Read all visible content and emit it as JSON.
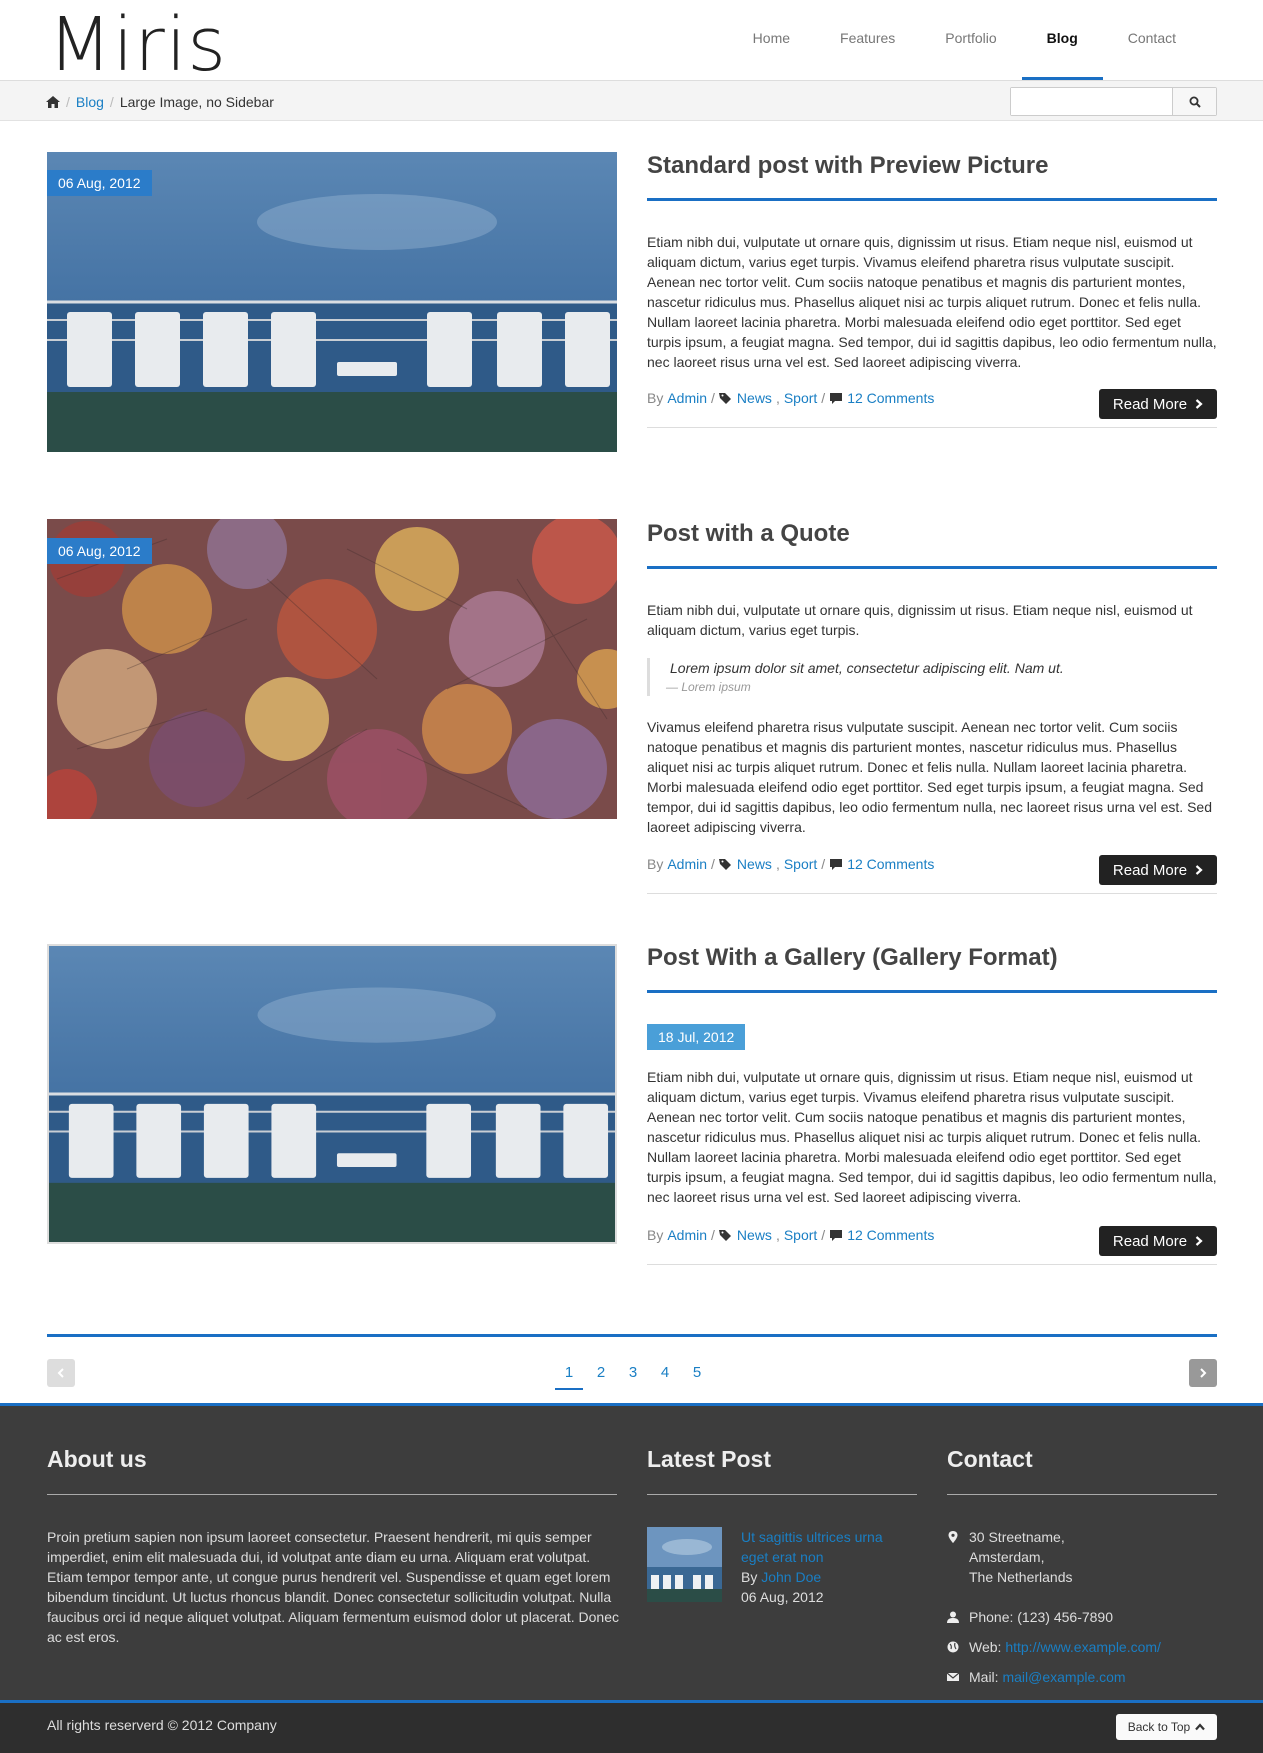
{
  "brand": {
    "logo": "Miris",
    "accent": "#1a6fc4"
  },
  "nav": {
    "items": [
      {
        "label": "Home",
        "active": false
      },
      {
        "label": "Features",
        "active": false
      },
      {
        "label": "Portfolio",
        "active": false
      },
      {
        "label": "Blog",
        "active": true
      },
      {
        "label": "Contact",
        "active": false
      }
    ]
  },
  "breadcrumb": {
    "home_icon": "home-icon",
    "blog": "Blog",
    "current": "Large Image, no Sidebar"
  },
  "search": {
    "placeholder": "",
    "icon": "search-icon"
  },
  "posts": [
    {
      "date": "06 Aug, 2012",
      "title": "Standard post with Preview Picture",
      "body": "Etiam nibh dui, vulputate ut ornare quis, dignissim ut risus. Etiam neque nisl, euismod ut aliquam dictum, varius eget turpis. Vivamus eleifend pharetra risus vulputate suscipit. Aenean nec tortor velit. Cum sociis natoque penatibus et magnis dis parturient montes, nascetur ridiculus mus. Phasellus aliquet nisi ac turpis aliquet rutrum. Donec et felis nulla. Nullam laoreet lacinia pharetra. Morbi malesuada eleifend odio eget porttitor. Sed eget turpis ipsum, a feugiat magna. Sed tempor, dui id sagittis dapibus, leo odio fermentum nulla, nec laoreet risus urna vel est. Sed laoreet adipiscing viverra.",
      "meta": {
        "by": "By",
        "author": "Admin",
        "tag1": "News",
        "tag2": "Sport",
        "comments": "12 Comments"
      },
      "read_more": "Read More"
    },
    {
      "date": "06 Aug, 2012",
      "title": "Post with a Quote",
      "body_intro": "Etiam nibh dui, vulputate ut ornare quis, dignissim ut risus. Etiam neque nisl, euismod ut aliquam dictum, varius eget turpis.",
      "quote": "Lorem ipsum dolor sit amet, consectetur adipiscing elit. Nam ut.",
      "quote_source": "— Lorem ipsum",
      "body": "Vivamus eleifend pharetra risus vulputate suscipit. Aenean nec tortor velit. Cum sociis natoque penatibus et magnis dis parturient montes, nascetur ridiculus mus. Phasellus aliquet nisi ac turpis aliquet rutrum. Donec et felis nulla. Nullam laoreet lacinia pharetra. Morbi malesuada eleifend odio eget porttitor. Sed eget turpis ipsum, a feugiat magna. Sed tempor, dui id sagittis dapibus, leo odio fermentum nulla, nec laoreet risus urna vel est. Sed laoreet adipiscing viverra.",
      "meta": {
        "by": "By",
        "author": "Admin",
        "tag1": "News",
        "tag2": "Sport",
        "comments": "12 Comments"
      },
      "read_more": "Read More"
    },
    {
      "date": "18 Jul, 2012",
      "title": "Post With a Gallery (Gallery Format)",
      "body": "Etiam nibh dui, vulputate ut ornare quis, dignissim ut risus. Etiam neque nisl, euismod ut aliquam dictum, varius eget turpis. Vivamus eleifend pharetra risus vulputate suscipit. Aenean nec tortor velit. Cum sociis natoque penatibus et magnis dis parturient montes, nascetur ridiculus mus. Phasellus aliquet nisi ac turpis aliquet rutrum. Donec et felis nulla. Nullam laoreet lacinia pharetra. Morbi malesuada eleifend odio eget porttitor. Sed eget turpis ipsum, a feugiat magna. Sed tempor, dui id sagittis dapibus, leo odio fermentum nulla, nec laoreet risus urna vel est. Sed laoreet adipiscing viverra.",
      "meta": {
        "by": "By",
        "author": "Admin",
        "tag1": "News",
        "tag2": "Sport",
        "comments": "12 Comments"
      },
      "read_more": "Read More"
    }
  ],
  "pagination": {
    "pages": [
      "1",
      "2",
      "3",
      "4",
      "5"
    ],
    "current": "1"
  },
  "footer": {
    "about": {
      "title": "About us",
      "text": "Proin pretium sapien non ipsum laoreet consectetur. Praesent hendrerit, mi quis semper imperdiet, enim elit malesuada dui, id volutpat ante diam eu urna. Aliquam erat volutpat. Etiam tempor tempor ante, ut congue purus hendrerit vel. Suspendisse et quam eget lorem bibendum tincidunt. Ut luctus rhoncus blandit. Donec consectetur sollicitudin volutpat. Nulla faucibus orci id neque aliquet volutpat. Aliquam fermentum euismod dolor ut placerat. Donec ac est eros."
    },
    "latest": {
      "title": "Latest Post",
      "post_title": "Ut sagittis ultrices urna eget erat non",
      "by": "By",
      "author": "John Doe",
      "date": "06 Aug, 2012"
    },
    "contact": {
      "title": "Contact",
      "address": [
        "30 Streetname,",
        "Amsterdam,",
        "The Netherlands"
      ],
      "phone": "Phone: (123) 456-7890",
      "web_label": "Web:",
      "web": "http://www.example.com/",
      "mail_label": "Mail:",
      "mail": "mail@example.com"
    },
    "copyright": "All rights reserverd © 2012 Company",
    "back_to_top": "Back to Top"
  }
}
